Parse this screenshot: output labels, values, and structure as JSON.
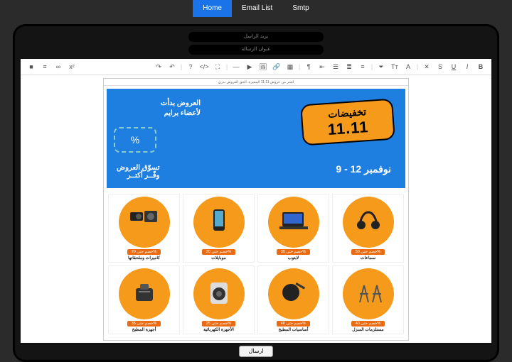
{
  "nav": {
    "home": "Home",
    "email_list": "Email List",
    "smtp": "Smtp"
  },
  "inputs": {
    "recipient_placeholder": "بريد الراسل",
    "subject_placeholder": "عنوان الرسالة"
  },
  "toolbar_names": [
    "bold",
    "italic",
    "underline",
    "strike",
    "font-color",
    "bg-color",
    "align",
    "unordered-list",
    "ordered-list",
    "indent",
    "outdent",
    "paragraph",
    "table",
    "link",
    "image",
    "video",
    "hr",
    "fullscreen",
    "code",
    "undo",
    "redo",
    "eraser",
    "format",
    "help"
  ],
  "page_head": "اشتر من عروض 11.11 المميزة، الحق العروض بدري",
  "banner": {
    "prime_l1": "العروض بدأت",
    "prime_l2": "لأعضاء برايم",
    "cta_l1": "تسوّق العروض",
    "cta_l2": "وفّــر أكتــر",
    "promo_l1": "تخفيضات",
    "promo_l2": "11.11",
    "dates": "9 - 12 نوفمبر",
    "ticket": "%"
  },
  "discount_prefix": "خصم حتى",
  "cats": [
    {
      "label": "كاميرات وملحقاتها",
      "pct": "20%"
    },
    {
      "label": "موبايلات",
      "pct": "20%"
    },
    {
      "label": "لابتوب",
      "pct": "30%"
    },
    {
      "label": "سماعات",
      "pct": "50%"
    },
    {
      "label": "أجهزة المطبخ",
      "pct": "35%"
    },
    {
      "label": "الأجهزة الكهربائية",
      "pct": "25%"
    },
    {
      "label": "أساسيات المطبخ",
      "pct": "40%"
    },
    {
      "label": "مستلزمات المنزل",
      "pct": "40%"
    }
  ],
  "send": "ارسال"
}
